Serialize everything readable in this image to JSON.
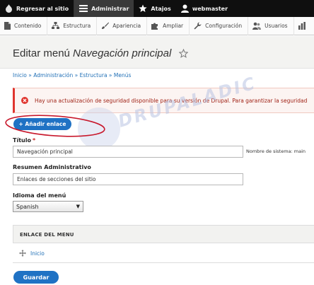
{
  "toolbar": {
    "back_label": "Regresar al sitio",
    "manage_label": "Administrar",
    "shortcuts_label": "Atajos",
    "user_label": "webmaster"
  },
  "tray": {
    "items": [
      {
        "label": "Contenido",
        "icon": "file-icon"
      },
      {
        "label": "Estructura",
        "icon": "structure-icon"
      },
      {
        "label": "Apariencia",
        "icon": "paintbrush-icon"
      },
      {
        "label": "Ampliar",
        "icon": "puzzle-icon"
      },
      {
        "label": "Configuración",
        "icon": "wrench-icon"
      },
      {
        "label": "Usuarios",
        "icon": "people-icon"
      }
    ]
  },
  "page": {
    "title_prefix": "Editar menú ",
    "title_em": "Navegación principal"
  },
  "breadcrumb": "Inicio » Administración » Estructura » Menús",
  "message": {
    "text": "Hay una actualización de seguridad disponible para su versión de Drupal. Para garantizar la seguridad"
  },
  "watermark": "DRUPALADICTO",
  "add_link_label": "+ Añadir enlace",
  "form": {
    "title_label": "Título",
    "required_mark": "*",
    "title_value": "Navegación principal",
    "machine_name": "Nombre de sistema: main",
    "summary_label": "Resumen Administrativo",
    "summary_value": "Enlaces de secciones del sitio",
    "language_label": "Idioma del menú",
    "language_value": "Spanish"
  },
  "table": {
    "header": "ENLACE DEL MENU",
    "rows": [
      {
        "label": "Inicio"
      }
    ]
  },
  "save_label": "Guardar",
  "colors": {
    "toolbar": "#0f0f0f",
    "primary_button": "#1f72c4",
    "link": "#1f6fb6",
    "error": "#e0352f",
    "annotation": "#c8182c"
  }
}
